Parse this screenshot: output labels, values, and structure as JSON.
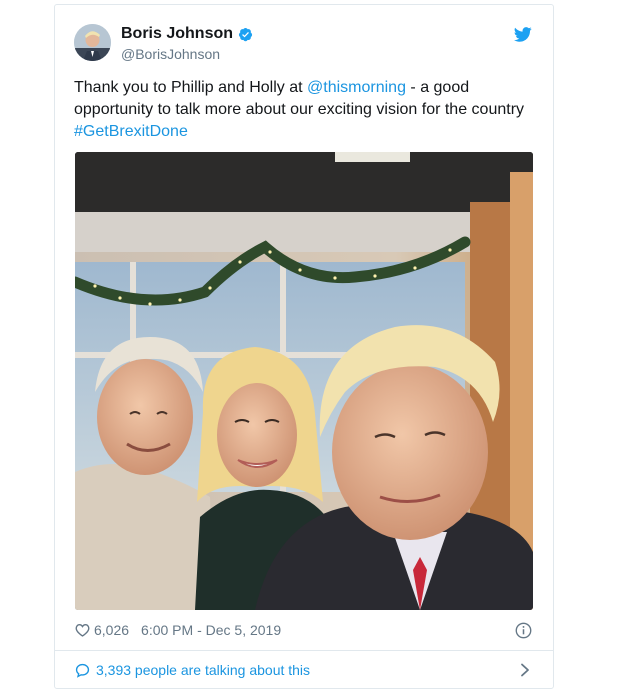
{
  "user": {
    "display_name": "Boris Johnson",
    "handle": "@BorisJohnson",
    "verified": true
  },
  "tweet": {
    "text_before": "Thank you to Phillip and Holly at ",
    "mention": "@thismorning",
    "text_after": " - a good opportunity to talk more about our exciting vision for the country",
    "hashtag": "#GetBrexitDone"
  },
  "footer": {
    "likes": "6,026",
    "timestamp": "6:00 PM - Dec 5, 2019",
    "conversation": "3,393 people are talking about this"
  },
  "colors": {
    "link": "#1b95e0",
    "muted": "#657786",
    "text": "#14171a",
    "border": "#e1e8ed"
  },
  "icons": [
    "verified-badge-icon",
    "twitter-bird-icon",
    "heart-icon",
    "info-icon",
    "speech-bubble-icon",
    "chevron-right-icon"
  ]
}
